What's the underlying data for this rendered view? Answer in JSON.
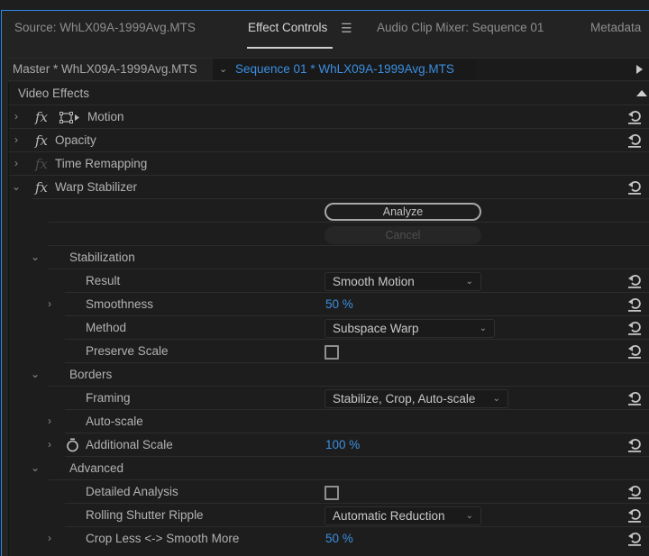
{
  "tabs": [
    {
      "label": "Source: WhLX09A-1999Avg.MTS",
      "active": false
    },
    {
      "label": "Effect Controls",
      "active": true
    },
    {
      "label": "Audio Clip Mixer: Sequence 01",
      "active": false
    },
    {
      "label": "Metadata",
      "active": false
    }
  ],
  "tab_menu_icon": "hamburger-menu-icon",
  "clip_bar": {
    "master": "Master * WhLX09A-1999Avg.MTS",
    "sequence": "Sequence 01 * WhLX09A-1999Avg.MTS"
  },
  "section": {
    "title": "Video Effects"
  },
  "effects": {
    "motion": "Motion",
    "opacity": "Opacity",
    "time_remapping": "Time Remapping",
    "warp_stabilizer": "Warp Stabilizer"
  },
  "fx_badge": "fx",
  "buttons": {
    "analyze": "Analyze",
    "cancel": "Cancel"
  },
  "groups": {
    "stabilization": "Stabilization",
    "borders": "Borders",
    "advanced": "Advanced"
  },
  "params": {
    "result": {
      "label": "Result",
      "value": "Smooth Motion"
    },
    "smoothness": {
      "label": "Smoothness",
      "value": "50 %"
    },
    "method": {
      "label": "Method",
      "value": "Subspace Warp"
    },
    "preserve_scale": {
      "label": "Preserve Scale",
      "checked": false
    },
    "framing": {
      "label": "Framing",
      "value": "Stabilize, Crop, Auto-scale"
    },
    "auto_scale": {
      "label": "Auto-scale"
    },
    "additional_scale": {
      "label": "Additional Scale",
      "value": "100 %"
    },
    "detailed_analysis": {
      "label": "Detailed Analysis",
      "checked": false
    },
    "rolling_shutter_ripple": {
      "label": "Rolling Shutter Ripple",
      "value": "Automatic Reduction"
    },
    "crop_less_smooth_more": {
      "label": "Crop Less <-> Smooth More",
      "value": "50 %"
    }
  },
  "glyphs": {
    "chevron_right": "›",
    "chevron_down": "⌄",
    "hamburger": "☰"
  },
  "colors": {
    "accent_blue": "#3b8fe0",
    "panel_border": "#2d8ceb",
    "background": "#1d1d1d"
  }
}
